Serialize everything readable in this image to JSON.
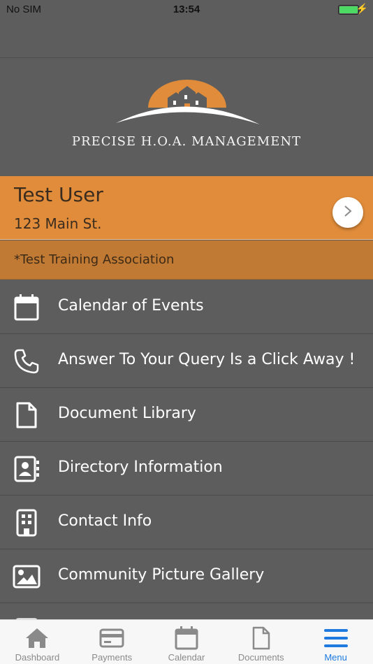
{
  "status_bar": {
    "carrier": "No SIM",
    "time": "13:54",
    "battery_level": 1.0
  },
  "logo": {
    "text": "PRECISE H.O.A. MANAGEMENT",
    "accent_color": "#e08c3a"
  },
  "user": {
    "name": "Test User",
    "address": "123 Main St.",
    "arrow_icon": "chevron-right-icon"
  },
  "association": {
    "name": "*Test Training Association"
  },
  "menu": {
    "items": [
      {
        "label": "Calendar of Events",
        "icon": "calendar-icon"
      },
      {
        "label": "Answer To Your Query Is a Click Away !",
        "icon": "phone-icon"
      },
      {
        "label": "Document Library",
        "icon": "document-icon"
      },
      {
        "label": "Directory Information",
        "icon": "contact-card-icon"
      },
      {
        "label": "Contact Info",
        "icon": "building-icon"
      },
      {
        "label": "Community Picture Gallery",
        "icon": "image-icon"
      }
    ]
  },
  "tabs": [
    {
      "label": "Dashboard",
      "icon": "home-icon",
      "active": false
    },
    {
      "label": "Payments",
      "icon": "credit-card-icon",
      "active": false
    },
    {
      "label": "Calendar",
      "icon": "calendar-icon",
      "active": false
    },
    {
      "label": "Documents",
      "icon": "document-icon",
      "active": false
    },
    {
      "label": "Menu",
      "icon": "menu-icon",
      "active": true
    }
  ],
  "colors": {
    "background": "#5d5d5d",
    "user_card": "#e08c3a",
    "association_bar": "#c17a33",
    "tab_active": "#1f7ae0",
    "tab_inactive": "#8a8a8a"
  }
}
